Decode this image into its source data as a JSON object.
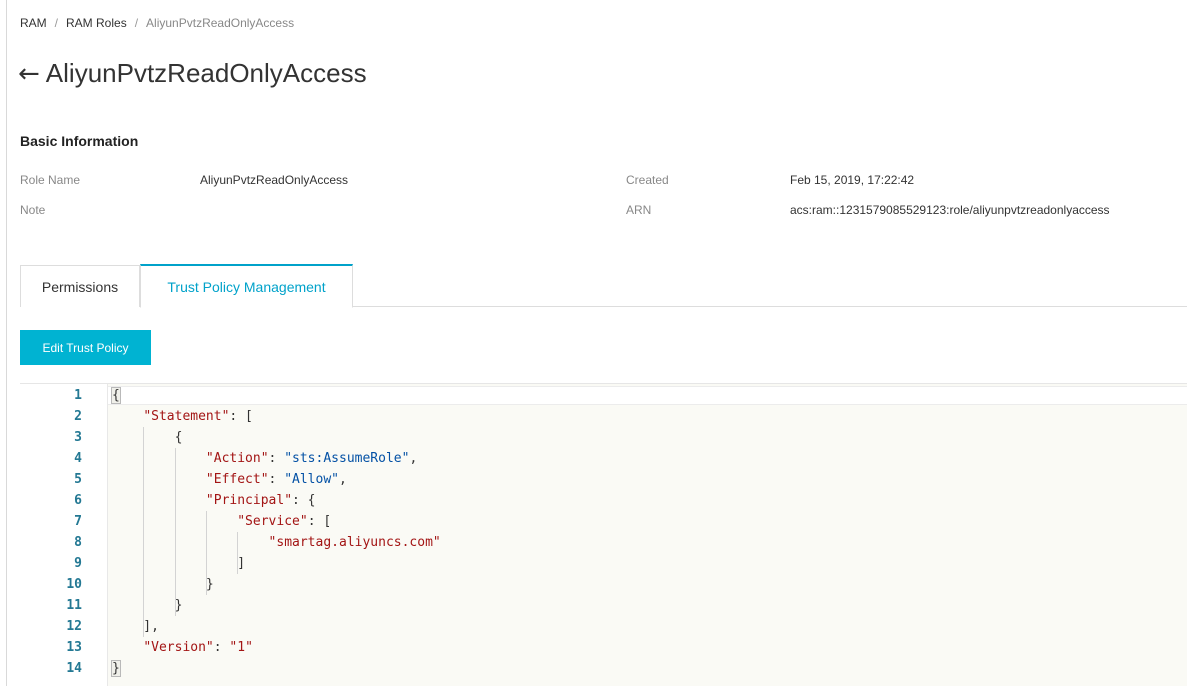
{
  "breadcrumb": {
    "items": [
      "RAM",
      "RAM Roles",
      "AliyunPvtzReadOnlyAccess"
    ],
    "separator": "/"
  },
  "page": {
    "back_icon": "left-arrow-icon",
    "title": "AliyunPvtzReadOnlyAccess"
  },
  "basic_info": {
    "heading": "Basic Information",
    "role_name_label": "Role Name",
    "role_name_value": "AliyunPvtzReadOnlyAccess",
    "note_label": "Note",
    "note_value": "",
    "created_label": "Created",
    "created_value": "Feb 15, 2019, 17:22:42",
    "arn_label": "ARN",
    "arn_value": "acs:ram::1231579085529123:role/aliyunpvtzreadonlyaccess"
  },
  "tabs": {
    "items": [
      "Permissions",
      "Trust Policy Management"
    ],
    "active": "Trust Policy Management"
  },
  "toolbar": {
    "edit_label": "Edit Trust Policy"
  },
  "editor": {
    "lines": [
      [
        {
          "t": "p",
          "v": "{"
        }
      ],
      [
        {
          "t": "p",
          "v": "    "
        },
        {
          "t": "k",
          "v": "\"Statement\""
        },
        {
          "t": "p",
          "v": ": ["
        }
      ],
      [
        {
          "t": "p",
          "v": "        {"
        }
      ],
      [
        {
          "t": "p",
          "v": "            "
        },
        {
          "t": "k",
          "v": "\"Action\""
        },
        {
          "t": "p",
          "v": ": "
        },
        {
          "t": "s",
          "v": "\"sts:AssumeRole\""
        },
        {
          "t": "p",
          "v": ","
        }
      ],
      [
        {
          "t": "p",
          "v": "            "
        },
        {
          "t": "k",
          "v": "\"Effect\""
        },
        {
          "t": "p",
          "v": ": "
        },
        {
          "t": "s",
          "v": "\"Allow\""
        },
        {
          "t": "p",
          "v": ","
        }
      ],
      [
        {
          "t": "p",
          "v": "            "
        },
        {
          "t": "k",
          "v": "\"Principal\""
        },
        {
          "t": "p",
          "v": ": {"
        }
      ],
      [
        {
          "t": "p",
          "v": "                "
        },
        {
          "t": "k",
          "v": "\"Service\""
        },
        {
          "t": "p",
          "v": ": ["
        }
      ],
      [
        {
          "t": "p",
          "v": "                    "
        },
        {
          "t": "k",
          "v": "\"smartag.aliyuncs.com\""
        }
      ],
      [
        {
          "t": "p",
          "v": "                ]"
        }
      ],
      [
        {
          "t": "p",
          "v": "            }"
        }
      ],
      [
        {
          "t": "p",
          "v": "        }"
        }
      ],
      [
        {
          "t": "p",
          "v": "    ],"
        }
      ],
      [
        {
          "t": "p",
          "v": "    "
        },
        {
          "t": "k",
          "v": "\"Version\""
        },
        {
          "t": "p",
          "v": ": "
        },
        {
          "t": "k",
          "v": "\"1\""
        }
      ],
      [
        {
          "t": "p",
          "v": "}"
        }
      ]
    ]
  },
  "colors": {
    "accent": "#00a2ca",
    "button": "#00b3d2",
    "json_key": "#a31515",
    "json_string": "#0451a5",
    "line_number": "#237893"
  }
}
